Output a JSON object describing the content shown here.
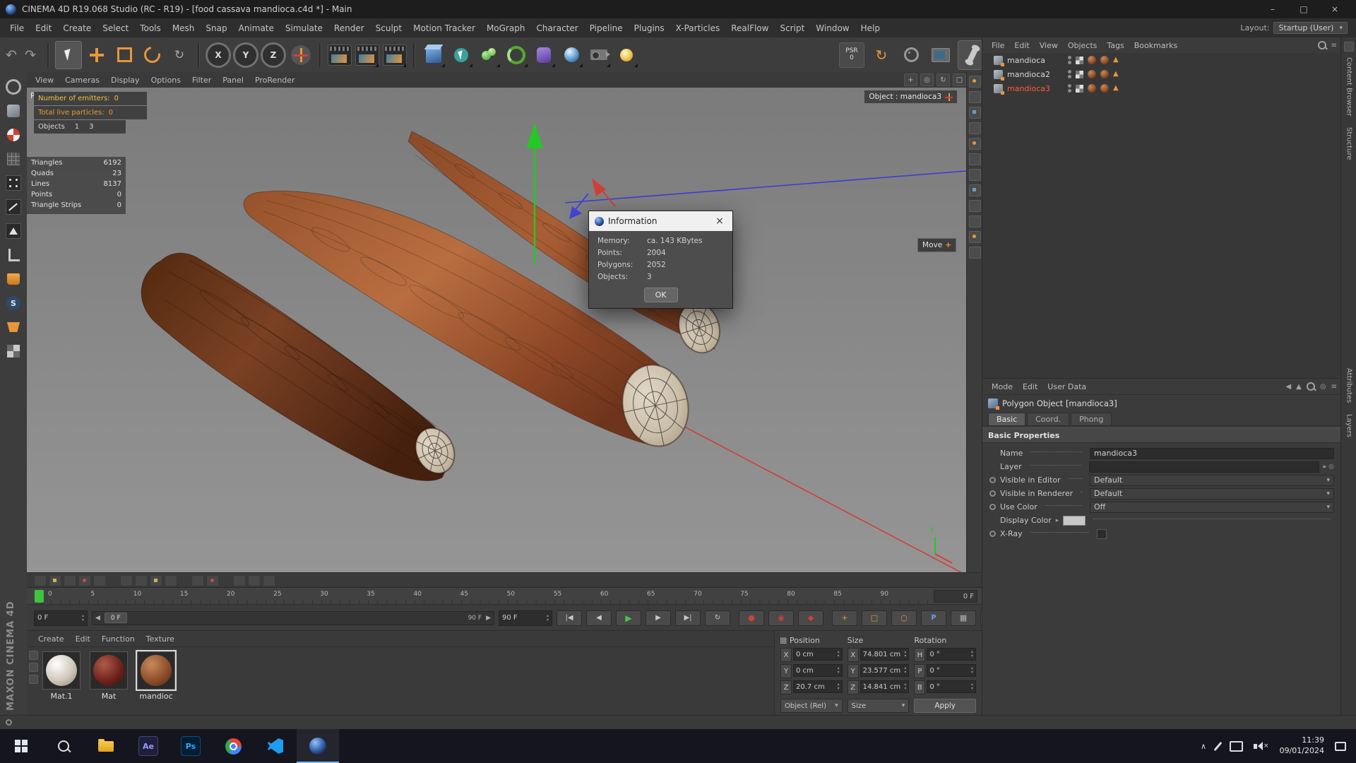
{
  "glyphs": {
    "undo": "↶",
    "redo": "↷",
    "minimize": "–",
    "maximize": "□",
    "close": "×",
    "dropdown": "▾",
    "tri_right": "▸",
    "spin_up": "▴",
    "spin_down": "▾",
    "slider_left": "◀",
    "slider_right": "▶",
    "goto_start": "|◀",
    "prev_frame": "◀",
    "play": "▶",
    "next_frame": "▶",
    "goto_end": "▶|",
    "loop": "↻",
    "record_dot": "●",
    "record_ring": "◉",
    "record_key": "◆",
    "plus": "+",
    "square": "□",
    "circle": "○",
    "letter_p": "P",
    "grid": "▦",
    "back": "◀",
    "up_tri": "▲",
    "menu": "≡",
    "target": "◎",
    "rotate_view": "↻",
    "chevron_up": "∧",
    "triangle_tag": "▲",
    "letter_s": "S",
    "recycle": "↻",
    "recent": "↻"
  },
  "window": {
    "title": "CINEMA 4D R19.068 Studio (RC - R19) - [food cassava mandioca.c4d *] - Main"
  },
  "menubar": {
    "items": [
      "File",
      "Edit",
      "Create",
      "Select",
      "Tools",
      "Mesh",
      "Snap",
      "Animate",
      "Simulate",
      "Render",
      "Sculpt",
      "Motion Tracker",
      "MoGraph",
      "Character",
      "Pipeline",
      "Plugins",
      "X-Particles",
      "RealFlow",
      "Script",
      "Window",
      "Help"
    ],
    "layout_label": "Layout:",
    "layout_value": "Startup (User)"
  },
  "toolbar": {
    "axis_locks": [
      "X",
      "Y",
      "Z"
    ],
    "psr_label": "PSR",
    "psr_value": "0"
  },
  "viewport": {
    "menu_items": [
      "View",
      "Cameras",
      "Display",
      "Options",
      "Filter",
      "Panel",
      "ProRender"
    ],
    "view_label": "P",
    "object_label": "Object : mandioca3",
    "move_label": "Move",
    "move_plus": "+",
    "axis_label_y": "Y",
    "hud": {
      "emitters_label": "Number of emitters:",
      "emitters_value": "0",
      "particles_label": "Total live particles:",
      "particles_value": "0",
      "objects_label": "Objects",
      "objects_v1": "1",
      "objects_v2": "3",
      "stats": [
        {
          "label": "Triangles",
          "value": "6192"
        },
        {
          "label": "Quads",
          "value": "23"
        },
        {
          "label": "Lines",
          "value": "8137"
        },
        {
          "label": "Points",
          "value": "0"
        },
        {
          "label": "Triangle Strips",
          "value": "0"
        }
      ]
    }
  },
  "dialog": {
    "title": "Information",
    "rows": [
      {
        "label": "Memory:",
        "value": "ca. 143 KBytes"
      },
      {
        "label": "Points:",
        "value": "2004"
      },
      {
        "label": "Polygons:",
        "value": "2052"
      },
      {
        "label": "Objects:",
        "value": "3"
      }
    ],
    "ok": "OK"
  },
  "object_manager": {
    "menu_items": [
      "File",
      "Edit",
      "View",
      "Objects",
      "Tags",
      "Bookmarks"
    ],
    "objects": [
      {
        "name": "mandioca",
        "state": "normal"
      },
      {
        "name": "mandioca2",
        "state": "normal"
      },
      {
        "name": "mandioca3",
        "state": "selected"
      }
    ]
  },
  "attribute_manager": {
    "menu_items": [
      "Mode",
      "Edit",
      "User Data"
    ],
    "object_title": "Polygon Object [mandioca3]",
    "tabs": [
      {
        "label": "Basic",
        "state": "active"
      },
      {
        "label": "Coord.",
        "state": "normal"
      },
      {
        "label": "Phong",
        "state": "normal"
      }
    ],
    "section": "Basic Properties",
    "name_label": "Name",
    "name_value": "mandioca3",
    "layer_label": "Layer",
    "rows": [
      {
        "label": "Visible in Editor",
        "value": "Default"
      },
      {
        "label": "Visible in Renderer",
        "value": "Default"
      },
      {
        "label": "Use Color",
        "value": "Off"
      }
    ],
    "display_color_label": "Display Color",
    "xray_label": "X-Ray"
  },
  "side_tabs": {
    "top": [
      "Content Browser",
      "Structure"
    ],
    "bottom": [
      "Attributes",
      "Layers"
    ]
  },
  "timeline": {
    "ticks": [
      "0",
      "5",
      "10",
      "15",
      "20",
      "25",
      "30",
      "35",
      "40",
      "45",
      "50",
      "55",
      "60",
      "65",
      "70",
      "75",
      "80",
      "85",
      "90"
    ],
    "end_box": "0 F",
    "frame_field": "0 F",
    "range_left": "0 F",
    "range_right": "90 F",
    "range_field": "90 F"
  },
  "materials": {
    "menu_items": [
      "Create",
      "Edit",
      "Function",
      "Texture"
    ],
    "items": [
      {
        "name": "Mat.1",
        "swatch": "light",
        "state": "normal"
      },
      {
        "name": "Mat",
        "swatch": "dark-red",
        "state": "normal"
      },
      {
        "name": "mandioc",
        "swatch": "brown",
        "state": "selected"
      }
    ]
  },
  "coordinates": {
    "headers": [
      "Position",
      "Size",
      "Rotation"
    ],
    "position": [
      {
        "axis": "X",
        "value": "0 cm"
      },
      {
        "axis": "Y",
        "value": "0 cm"
      },
      {
        "axis": "Z",
        "value": "20.7 cm"
      }
    ],
    "size": [
      {
        "axis": "X",
        "value": "74.801 cm"
      },
      {
        "axis": "Y",
        "value": "23.577 cm"
      },
      {
        "axis": "Z",
        "value": "14.841 cm"
      }
    ],
    "rotation": [
      {
        "axis": "H",
        "value": "0 °"
      },
      {
        "axis": "P",
        "value": "0 °"
      },
      {
        "axis": "B",
        "value": "0 °"
      }
    ],
    "object_mode": "Object (Rel)",
    "size_mode": "Size",
    "apply": "Apply"
  },
  "branding": "MAXON CINEMA 4D",
  "taskbar": {
    "ae": "Ae",
    "ps": "Ps",
    "time": "11:39",
    "date": "09/01/2024"
  }
}
